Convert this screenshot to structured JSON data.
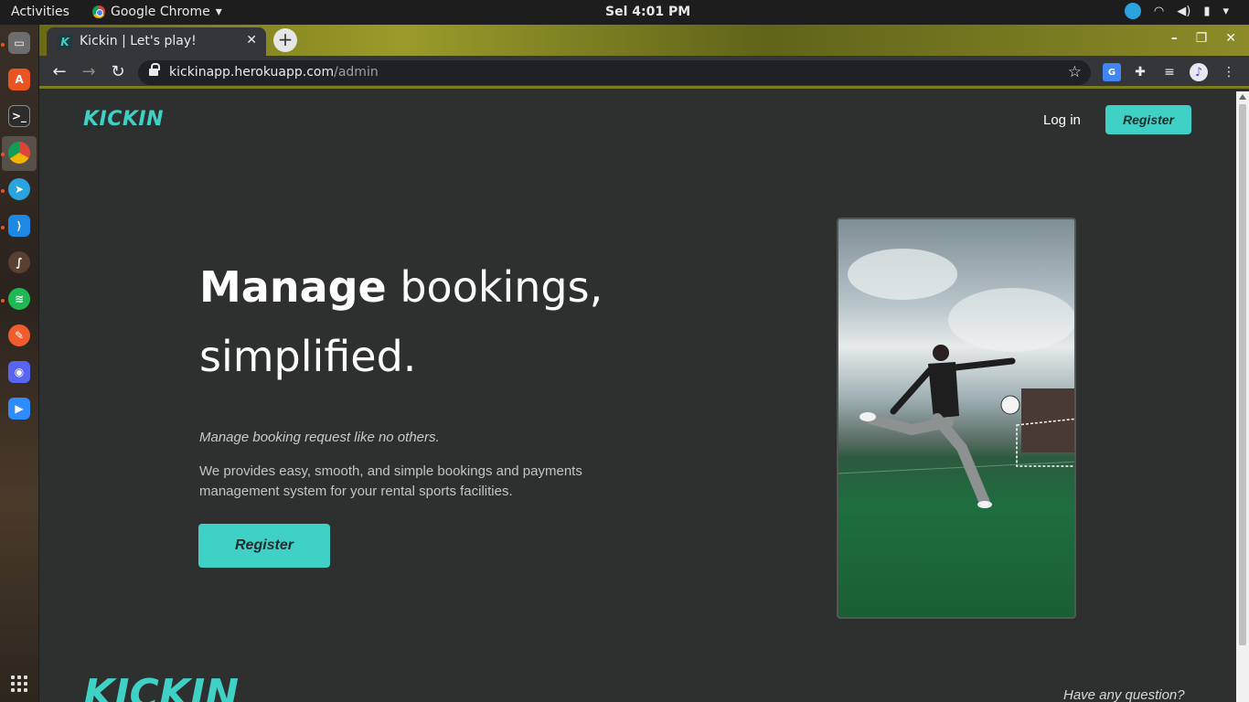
{
  "system": {
    "activities": "Activities",
    "app_menu": "Google Chrome",
    "clock": "Sel  4:01 PM"
  },
  "dock": {
    "items": [
      "files-icon",
      "software-icon",
      "terminal-icon",
      "chrome-icon",
      "telegram-icon",
      "vscode-icon",
      "app-icon",
      "spotify-icon",
      "browser-icon",
      "discord-icon",
      "zoom-icon"
    ]
  },
  "browser": {
    "tab_title": "Kickin | Let's play!",
    "favicon_letter": "K",
    "url_host": "kickinapp.herokuapp.com",
    "url_path": "/admin"
  },
  "page": {
    "brand": "KICKIN",
    "nav": {
      "login": "Log in",
      "register": "Register"
    },
    "hero": {
      "headline_bold": "Manage",
      "headline_rest": " bookings, simplified.",
      "tagline": "Manage booking request like no others.",
      "description": "We provides easy, smooth, and simple bookings and payments management system for your rental sports facilities.",
      "cta": "Register"
    },
    "footer": {
      "brand": "KICKIN",
      "question": "Have any question?"
    }
  },
  "colors": {
    "accent": "#3fd1c6",
    "page_bg": "#2e2f2f"
  }
}
